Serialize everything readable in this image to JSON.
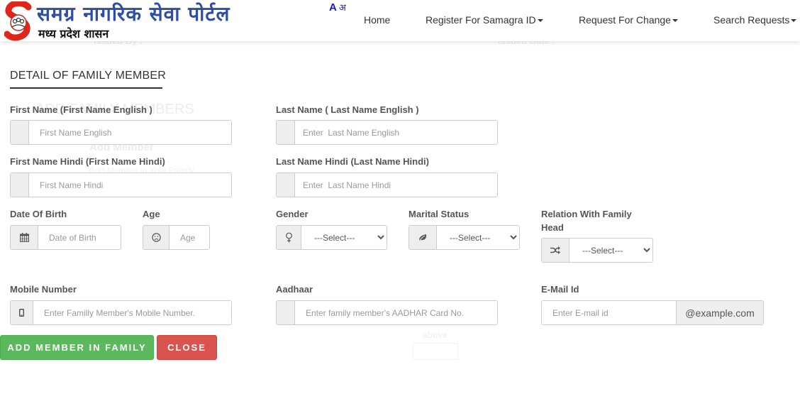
{
  "header": {
    "logo_title": "समग्र नागरिक सेवा पोर्टल",
    "logo_subtitle": "मध्य प्रदेश शासन",
    "lang_english": "A",
    "lang_hindi": "अ",
    "nav": [
      {
        "label": "Home",
        "dropdown": false
      },
      {
        "label": "Register For Samagra ID",
        "dropdown": true
      },
      {
        "label": "Request For Change",
        "dropdown": true
      },
      {
        "label": "Search Requests",
        "dropdown": true
      }
    ]
  },
  "background_ghost": {
    "issued_by": "Issued By :",
    "issued_date": "Issued Date :",
    "add_family_members": "ADD FAMILY MEMBERS",
    "add_member": "Add Member",
    "add_member_sub": "Add Member in Your Family",
    "above": "above"
  },
  "form": {
    "title": "DETAIL OF FAMILY MEMBER",
    "first_name_en": {
      "label": "First Name (First Name English )",
      "placeholder": "First Name English",
      "value": ""
    },
    "last_name_en": {
      "label": "Last Name ( Last Name English )",
      "placeholder": "Enter  Last Name English",
      "value": ""
    },
    "first_name_hi": {
      "label": "First Name Hindi (First Name Hindi)",
      "placeholder": "First Name Hindi",
      "value": ""
    },
    "last_name_hi": {
      "label": "Last Name Hindi (Last Name Hindi)",
      "placeholder": "Enter  Last Name Hindi",
      "value": ""
    },
    "dob": {
      "label": "Date Of Birth",
      "placeholder": "Date of Birth",
      "value": "",
      "icon": "calendar-icon"
    },
    "age": {
      "label": "Age",
      "placeholder": "Age",
      "value": "",
      "icon": "frown-icon"
    },
    "gender": {
      "label": "Gender",
      "selected": "---Select---",
      "icon": "female-icon"
    },
    "marital_status": {
      "label": "Marital Status",
      "selected": "---Select---",
      "icon": "leaf-icon"
    },
    "relation": {
      "label": "Relation With Family Head",
      "selected": "---Select---",
      "icon": "shuffle-icon"
    },
    "mobile": {
      "label": "Mobile Number",
      "placeholder": "Enter Familly Member's Mobile Number.",
      "value": "",
      "icon": "mobile-icon"
    },
    "aadhaar": {
      "label": "Aadhaar",
      "placeholder": "Enter family member's AADHAR Card No.",
      "value": ""
    },
    "email": {
      "label": "E-Mail Id",
      "placeholder": "Enter E-mail id",
      "value": "",
      "suffix": "@example.com"
    },
    "add_button": "ADD MEMBER IN FAMILY",
    "close_button": "CLOSE"
  }
}
